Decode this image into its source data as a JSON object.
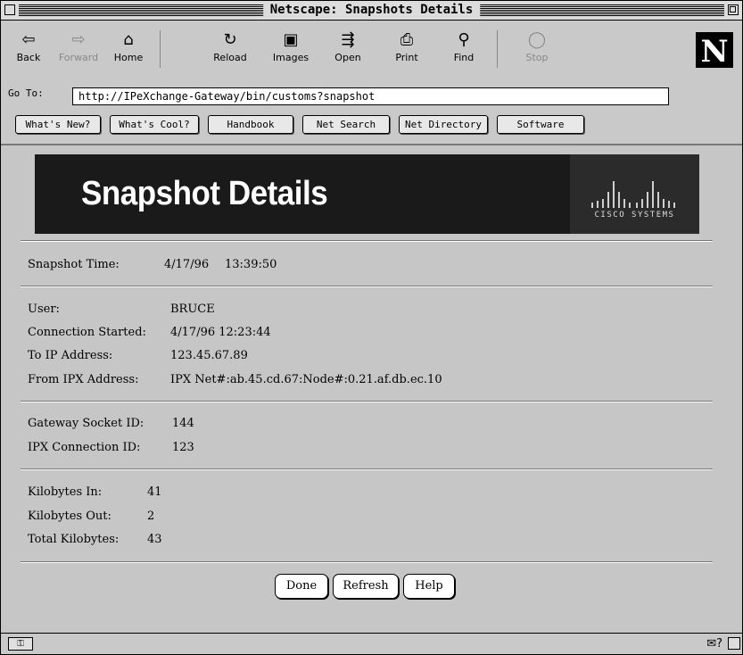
{
  "window": {
    "title": "Netscape: Snapshots Details"
  },
  "toolbar": {
    "buttons": [
      {
        "label": "Back",
        "icon": "back-arrow-icon",
        "glyph": "⇦"
      },
      {
        "label": "Forward",
        "icon": "forward-arrow-icon",
        "glyph": "⇨"
      },
      {
        "label": "Home",
        "icon": "home-icon",
        "glyph": "⌂"
      },
      {
        "label": "Reload",
        "icon": "reload-icon",
        "glyph": "↻"
      },
      {
        "label": "Images",
        "icon": "images-icon",
        "glyph": "▣"
      },
      {
        "label": "Open",
        "icon": "open-icon",
        "glyph": "⇶"
      },
      {
        "label": "Print",
        "icon": "print-icon",
        "glyph": "⎙"
      },
      {
        "label": "Find",
        "icon": "find-icon",
        "glyph": "⚲"
      },
      {
        "label": "Stop",
        "icon": "stop-icon",
        "glyph": "◯"
      }
    ],
    "goto_label": "Go To:",
    "url": "http://IPeXchange-Gateway/bin/customs?snapshot",
    "directory": [
      "What's New?",
      "What's Cool?",
      "Handbook",
      "Net Search",
      "Net Directory",
      "Software"
    ],
    "logo_letter": "N"
  },
  "banner": {
    "title": "Snapshot Details",
    "logo_text": "CISCO SYSTEMS"
  },
  "snapshot": {
    "label": "Snapshot Time:",
    "date": "4/17/96",
    "time": "13:39:50"
  },
  "connection": [
    {
      "label": "User:",
      "value": "BRUCE"
    },
    {
      "label": "Connection Started:",
      "value": "4/17/96 12:23:44"
    },
    {
      "label": "To IP Address:",
      "value": "123.45.67.89"
    },
    {
      "label": "From IPX Address:",
      "value": "IPX Net#:ab.45.cd.67:Node#:0.21.af.db.ec.10"
    }
  ],
  "ids": [
    {
      "label": "Gateway Socket ID:",
      "value": "144"
    },
    {
      "label": "IPX Connection ID:",
      "value": "123"
    }
  ],
  "kilobytes": [
    {
      "label": "Kilobytes In:",
      "value": "41"
    },
    {
      "label": "Kilobytes Out:",
      "value": "2"
    },
    {
      "label": "Total Kilobytes:",
      "value": "43"
    }
  ],
  "actions": {
    "done": "Done",
    "refresh": "Refresh",
    "help": "Help"
  }
}
